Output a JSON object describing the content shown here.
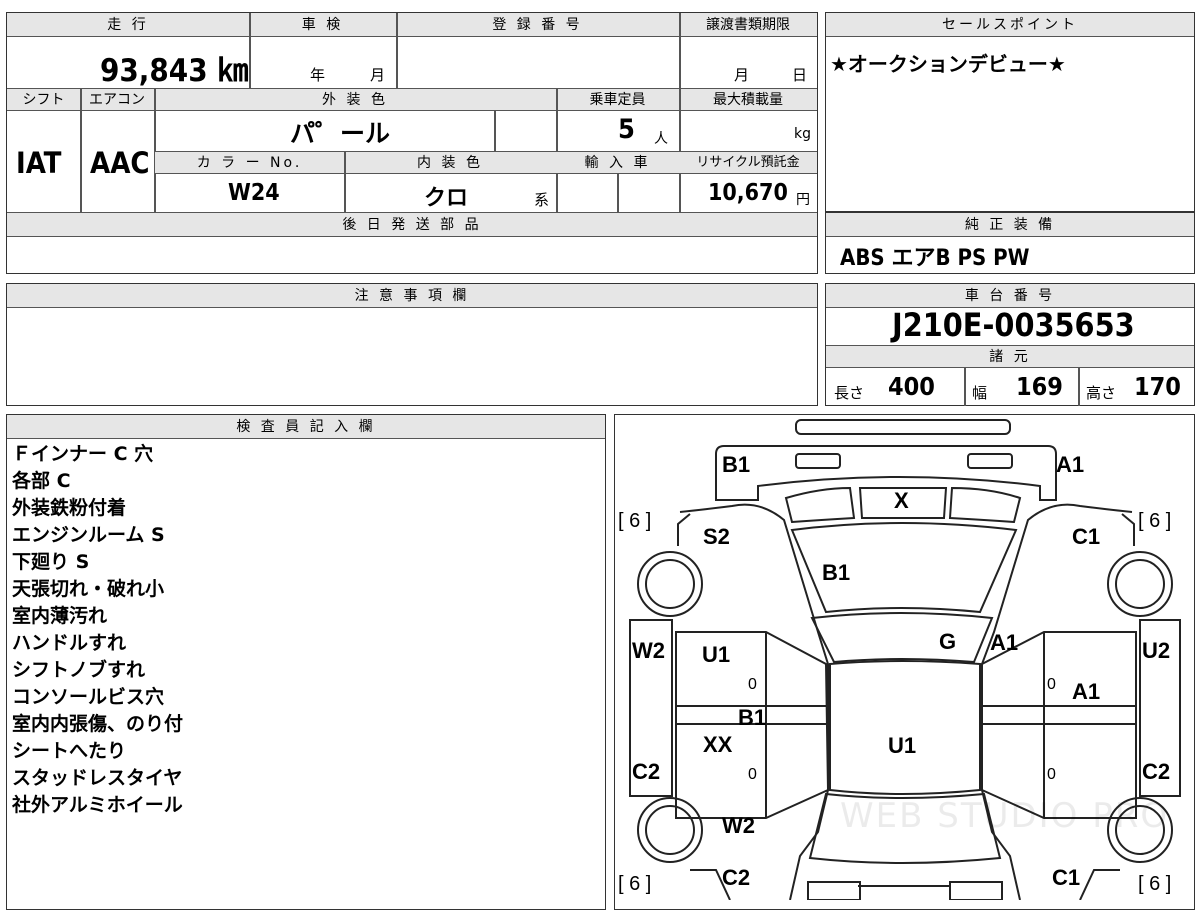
{
  "top": {
    "mileage_label": "走 行",
    "mileage_value": "93,843 ㎞",
    "inspection_label": "車 検",
    "inspection_year": "年",
    "inspection_month": "月",
    "registration_label": "登 録 番 号",
    "transfer_label": "譲渡書類期限",
    "transfer_month": "月",
    "transfer_day": "日"
  },
  "sales": {
    "label": "セールスポイント",
    "text": "★オークションデビュー★"
  },
  "row2": {
    "shift_label": "シフト",
    "ac_label": "エアコン",
    "exterior_label": "外 装 色",
    "capacity_label": "乗車定員",
    "maxload_label": "最大積載量",
    "shift_value": "IAT",
    "ac_value": "AAC",
    "exterior_value": "パ゜ール",
    "capacity_value": "5",
    "capacity_unit": "人",
    "maxload_unit": "kg",
    "color_no_label": "カ ラ ー No.",
    "interior_label": "内 装 色",
    "import_label": "輸 入 車",
    "recycle_label": "リサイクル預託金",
    "color_no_value": "W24",
    "interior_value": "クロ",
    "interior_suffix": "系",
    "recycle_value": "10,670",
    "recycle_unit": "円"
  },
  "later_parts": {
    "label": "後 日 発 送 部 品"
  },
  "equipment": {
    "label": "純 正 装 備",
    "value": "ABS エアB PS PW"
  },
  "caution": {
    "label": "注 意 事 項 欄"
  },
  "chassis": {
    "label": "車 台 番 号",
    "value": "J210E-0035653",
    "spec_label": "諸 元",
    "length_label": "長さ",
    "length_value": "400",
    "width_label": "幅",
    "width_value": "169",
    "height_label": "高さ",
    "height_value": "170"
  },
  "inspector": {
    "label": "検 査 員 記 入 欄",
    "lines": [
      "Ｆインナー C 穴",
      "各部 C",
      "外装鉄粉付着",
      "エンジンルーム S",
      "下廻り S",
      "天張切れ・破れ小",
      "室内薄汚れ",
      "ハンドルすれ",
      "シフトノブすれ",
      "コンソールビス穴",
      "室内内張傷、のり付",
      "シートへたり",
      "スタッドレスタイヤ",
      "社外アルミホイール"
    ]
  },
  "diagram": {
    "marks": {
      "front_left": "B1",
      "front_right": "A1",
      "top_center": "X",
      "left_front_fender": "S2",
      "right_front_fender": "C1",
      "hood": "B1",
      "windshield": "G",
      "roof_front_right": "A1",
      "left_front_door_edge": "W2",
      "left_front_door": "U1",
      "right_front_door_edge": "U2",
      "right_front_door": "A1",
      "left_pillar": "B1",
      "left_rear_door": "XX",
      "roof": "U1",
      "left_rear_quarter": "C2",
      "right_rear_quarter": "C2",
      "left_rear": "W2",
      "rear_bottom_left": "C2",
      "rear_bottom_right": "C1",
      "zero1": "0",
      "zero2": "0",
      "zero3": "0",
      "zero4": "0"
    },
    "tires": {
      "front_left": "[ 6 ]",
      "front_right": "[ 6 ]",
      "rear_left": "[ 6 ]",
      "rear_right": "[ 6 ]"
    },
    "watermark": "WEB STUDIO PRO"
  }
}
